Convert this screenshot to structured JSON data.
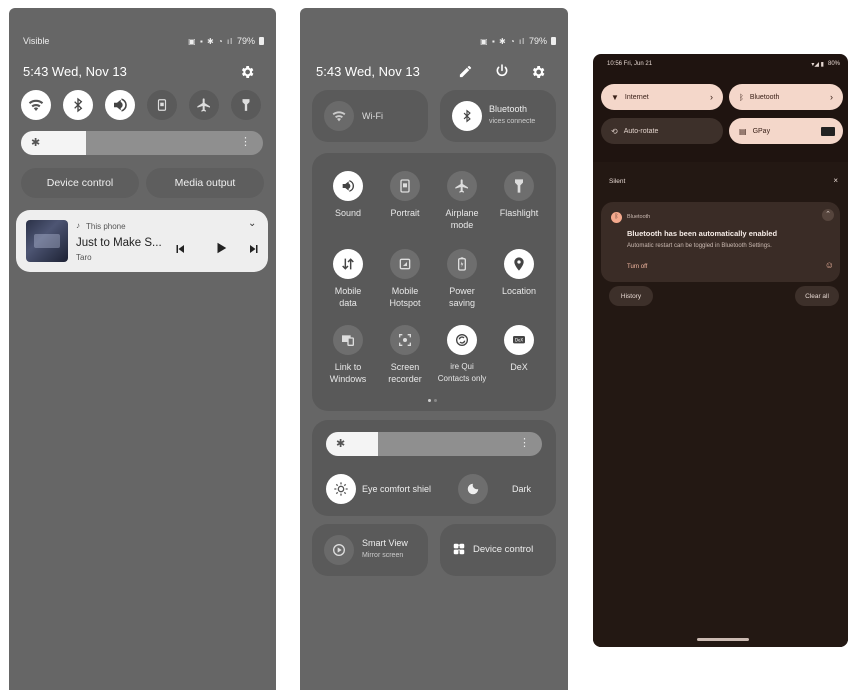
{
  "phone1": {
    "status_left": "Visible",
    "status_battery": "79%",
    "clock": "5:43  Wed, Nov 13",
    "icons": [
      "wifi-icon",
      "bluetooth-icon",
      "sound-icon",
      "portrait-icon",
      "airplane-icon",
      "flashlight-icon"
    ],
    "brightness_level": 0.27,
    "device_control_label": "Device control",
    "media_output_label": "Media output",
    "media": {
      "source": "This phone",
      "title": "Just to Make S...",
      "artist": "Taro"
    }
  },
  "phone2": {
    "status_battery": "79%",
    "clock": "5:43  Wed, Nov 13",
    "wifi_label": "Wi-Fi",
    "bluetooth_label": "Bluetooth",
    "bluetooth_sub": "vices connecte",
    "grid": [
      {
        "label": "Sound",
        "on": true,
        "icon": "sound-icon"
      },
      {
        "label": "Portrait",
        "on": false,
        "icon": "portrait-icon"
      },
      {
        "label": "Airplane\nmode",
        "on": false,
        "icon": "airplane-icon"
      },
      {
        "label": "Flashlight",
        "on": false,
        "icon": "flashlight-icon"
      },
      {
        "label": "Mobile\ndata",
        "on": true,
        "icon": "mobile-data-icon"
      },
      {
        "label": "Mobile\nHotspot",
        "on": false,
        "icon": "hotspot-icon"
      },
      {
        "label": "Power\nsaving",
        "on": false,
        "icon": "power-saving-icon"
      },
      {
        "label": "Location",
        "on": true,
        "icon": "location-icon"
      },
      {
        "label": "Link to\nWindows",
        "on": false,
        "icon": "link-windows-icon"
      },
      {
        "label": "Screen\nrecorder",
        "on": false,
        "icon": "screen-recorder-icon"
      },
      {
        "label": "ire   Qui\nContacts only",
        "on": true,
        "icon": "quick-share-icon"
      },
      {
        "label": "DeX",
        "on": true,
        "icon": "dex-icon"
      }
    ],
    "brightness_level": 0.24,
    "eye_comfort_label": "Eye comfort shiel",
    "dark_label": "Dark",
    "smart_view_label": "Smart View",
    "smart_view_sub": "Mirror screen",
    "device_control_label": "Device control"
  },
  "phone3": {
    "status_time": "10:56  Fri, Jun 21",
    "status_battery": "80%",
    "chips": {
      "internet": "Internet",
      "bluetooth": "Bluetooth",
      "auto_rotate": "Auto-rotate",
      "gpay": "GPay"
    },
    "section_label": "Silent",
    "notification": {
      "app": "Bluetooth",
      "title": "Bluetooth has been automatically enabled",
      "body": "Automatic restart can be toggled in Bluetooth Settings.",
      "action": "Turn off"
    },
    "history_label": "History",
    "clear_all_label": "Clear all"
  },
  "colors": {
    "panel_gray": "#666666",
    "tile_gray": "#5a5a5a",
    "pixel_bg": "#1f1410",
    "pixel_chip": "#f4d7ca",
    "pixel_notif": "#3a2c26"
  }
}
